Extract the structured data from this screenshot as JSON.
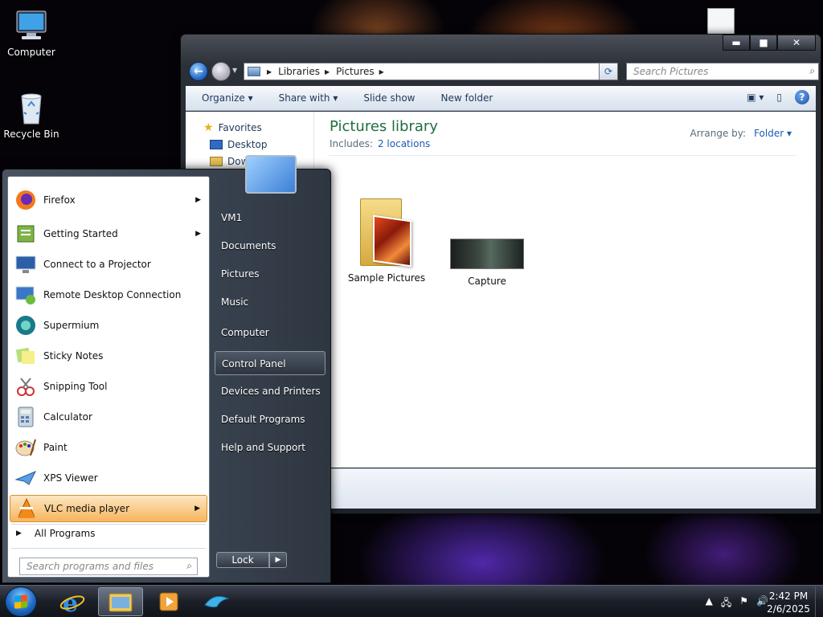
{
  "desktop": {
    "icons": [
      {
        "label": "Computer"
      },
      {
        "label": "Recycle Bin"
      }
    ]
  },
  "explorer": {
    "window_buttons": {
      "minimize": "▬",
      "maximize": "■",
      "close": "✕"
    },
    "breadcrumb": [
      "Libraries",
      "Pictures"
    ],
    "search_placeholder": "Search Pictures",
    "toolbar": {
      "organize": "Organize ▾",
      "share_with": "Share with ▾",
      "slide_show": "Slide show",
      "new_folder": "New folder"
    },
    "navpane": {
      "favorites": "Favorites",
      "items": [
        "Desktop",
        "Dow"
      ]
    },
    "library": {
      "title": "Pictures library",
      "includes_label": "Includes:",
      "includes_link": "2 locations",
      "arrange_label": "Arrange by:",
      "arrange_value": "Folder ▾"
    },
    "items": [
      {
        "label": "Sample Pictures",
        "type": "folder"
      },
      {
        "label": "Capture",
        "type": "image"
      }
    ]
  },
  "start_menu": {
    "programs": [
      {
        "label": "Firefox",
        "has_submenu": true,
        "icon": "firefox-icon"
      },
      {
        "label": "Getting Started",
        "has_submenu": true,
        "icon": "getting-started-icon"
      },
      {
        "label": "Connect to a Projector",
        "has_submenu": false,
        "icon": "projector-icon"
      },
      {
        "label": "Remote Desktop Connection",
        "has_submenu": false,
        "icon": "remote-desktop-icon"
      },
      {
        "label": "Supermium",
        "has_submenu": false,
        "icon": "supermium-icon"
      },
      {
        "label": "Sticky Notes",
        "has_submenu": false,
        "icon": "sticky-notes-icon"
      },
      {
        "label": "Snipping Tool",
        "has_submenu": false,
        "icon": "snipping-tool-icon"
      },
      {
        "label": "Calculator",
        "has_submenu": false,
        "icon": "calculator-icon"
      },
      {
        "label": "Paint",
        "has_submenu": false,
        "icon": "paint-icon"
      },
      {
        "label": "XPS Viewer",
        "has_submenu": false,
        "icon": "xps-viewer-icon"
      },
      {
        "label": "VLC media player",
        "has_submenu": true,
        "icon": "vlc-icon",
        "highlighted": true
      }
    ],
    "all_programs": "All Programs",
    "search_placeholder": "Search programs and files",
    "right_items": [
      "VM1",
      "Documents",
      "Pictures",
      "Music",
      "Computer",
      "Control Panel",
      "Devices and Printers",
      "Default Programs",
      "Help and Support"
    ],
    "highlighted_right": "Control Panel",
    "lock_label": "Lock"
  },
  "taskbar": {
    "time": "2:42 PM",
    "date": "2/6/2025"
  },
  "colors": {
    "library_title": "#1e6f3e",
    "link": "#1e5bb3",
    "highlight": "#f6b45e"
  }
}
